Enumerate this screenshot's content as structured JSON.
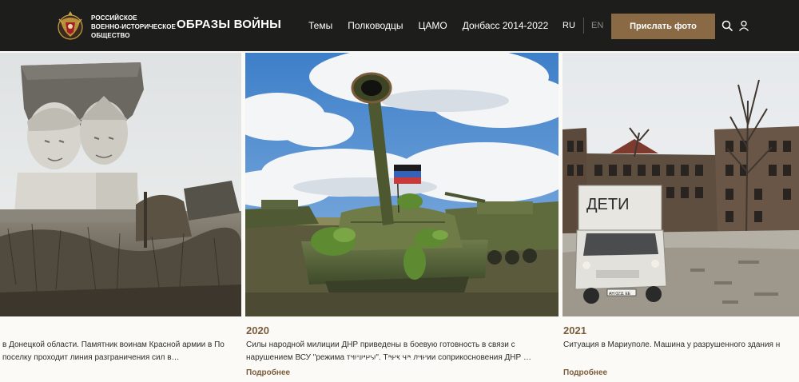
{
  "header": {
    "org_lines": [
      "РОССИЙСКОЕ",
      "ВОЕННО-ИСТОРИЧЕСКОЕ",
      "ОБЩЕСТВО"
    ],
    "site_title": "ОБРАЗЫ ВОЙНЫ",
    "nav": [
      {
        "label": "Темы"
      },
      {
        "label": "Полководцы"
      },
      {
        "label": "ЦАМО"
      },
      {
        "label": "Донбасс 2014-2022"
      }
    ],
    "lang_active": "RU",
    "lang_other": "EN",
    "send_photo_label": "Прислать фото",
    "icons": {
      "search": "search-icon",
      "user": "user-icon",
      "emblem": "rvio-emblem"
    }
  },
  "colors": {
    "header_bg": "#1d1d1b",
    "accent": "#8a6a45",
    "link": "#7a5c3b",
    "page_bg": "#fbfaf6"
  },
  "slides": [
    {
      "year": "",
      "caption": "в Донецкой области. Памятник воинам Красной армии в По поселку проходит линия разграничения сил в…",
      "more_label": ""
    },
    {
      "year": "2020",
      "caption": "Силы народной милиции ДНР приведены в боевую готовность в связи с нарушением ВСУ \"режима тишины\". Танк на линии соприкосновения ДНР …",
      "more_label": "Подробнее"
    },
    {
      "year": "2021",
      "caption": "Ситуация в Мариуполе. Машина у разрушенного здания н",
      "more_label": "Подробнее"
    }
  ],
  "truck_sign": "ДЕТИ",
  "truck_plate": "АН 0211 ЕЕ",
  "carousel": {
    "dot_count": 12
  }
}
